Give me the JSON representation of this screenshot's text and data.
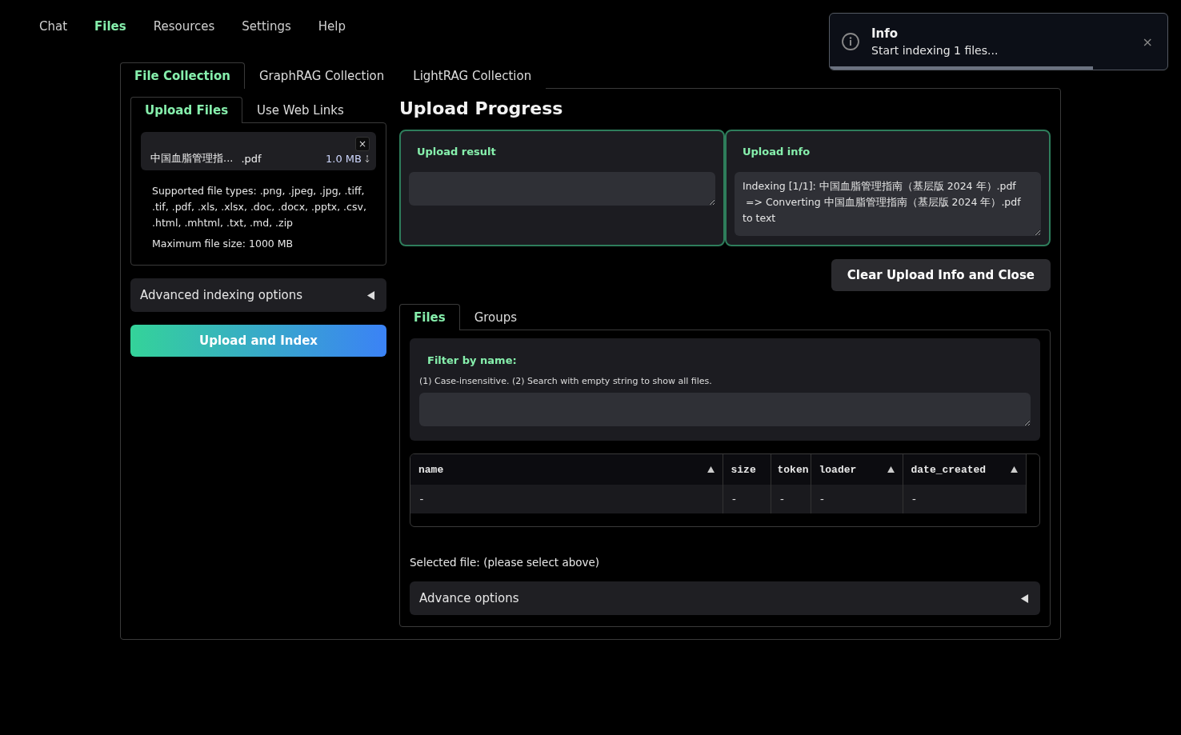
{
  "nav": [
    {
      "label": "Chat",
      "selected": false
    },
    {
      "label": "Files",
      "selected": true
    },
    {
      "label": "Resources",
      "selected": false
    },
    {
      "label": "Settings",
      "selected": false
    },
    {
      "label": "Help",
      "selected": false
    }
  ],
  "toast": {
    "title": "Info",
    "message": "Start indexing 1 files...",
    "close": "×",
    "level": 0.78
  },
  "collection_tabs": [
    {
      "label": "File Collection",
      "selected": true
    },
    {
      "label": "GraphRAG Collection",
      "selected": false
    },
    {
      "label": "LightRAG Collection",
      "selected": false
    }
  ],
  "upload_tabs": [
    {
      "label": "Upload Files",
      "selected": true
    },
    {
      "label": "Use Web Links",
      "selected": false
    }
  ],
  "file": {
    "name": "中国血脂管理指...",
    "ext": ".pdf",
    "size": "1.0 MB",
    "remove": "×"
  },
  "notes": [
    "Supported file types: .png, .jpeg, .jpg, .tiff, .tif, .pdf, .xls, .xlsx, .doc, .docx, .pptx, .csv, .html, .mhtml, .txt, .md, .zip",
    "Maximum file size: 1000 MB"
  ],
  "advanced_indexing": {
    "label": "Advanced indexing options",
    "expanded": false
  },
  "upload_button": "Upload and Index",
  "progress": {
    "title": "Upload Progress",
    "result_label": "Upload result",
    "info_label": "Upload info",
    "info_value": "Indexing [1/1]: 中国血脂管理指南（基层版 2024 年）.pdf\n => Converting 中国血脂管理指南（基层版 2024 年）.pdf to text"
  },
  "clear_button": "Clear Upload Info and Close",
  "file_tabs": [
    {
      "label": "Files",
      "selected": true
    },
    {
      "label": "Groups",
      "selected": false
    }
  ],
  "filter": {
    "label": "Filter by name:",
    "hint": "(1) Case-insensitive. (2) Search with empty string to show all files."
  },
  "table": {
    "columns": [
      {
        "label": "name",
        "sorted": true
      },
      {
        "label": "size",
        "sorted": false
      },
      {
        "label": "token",
        "sorted": false
      },
      {
        "label": "loader",
        "sorted": true
      },
      {
        "label": "date_created",
        "sorted": true
      }
    ],
    "rows": [
      [
        "-",
        "-",
        "-",
        "-",
        "-"
      ]
    ]
  },
  "selected_file": "Selected file: (please select above)",
  "advance_options": {
    "label": "Advance options",
    "expanded": false
  }
}
